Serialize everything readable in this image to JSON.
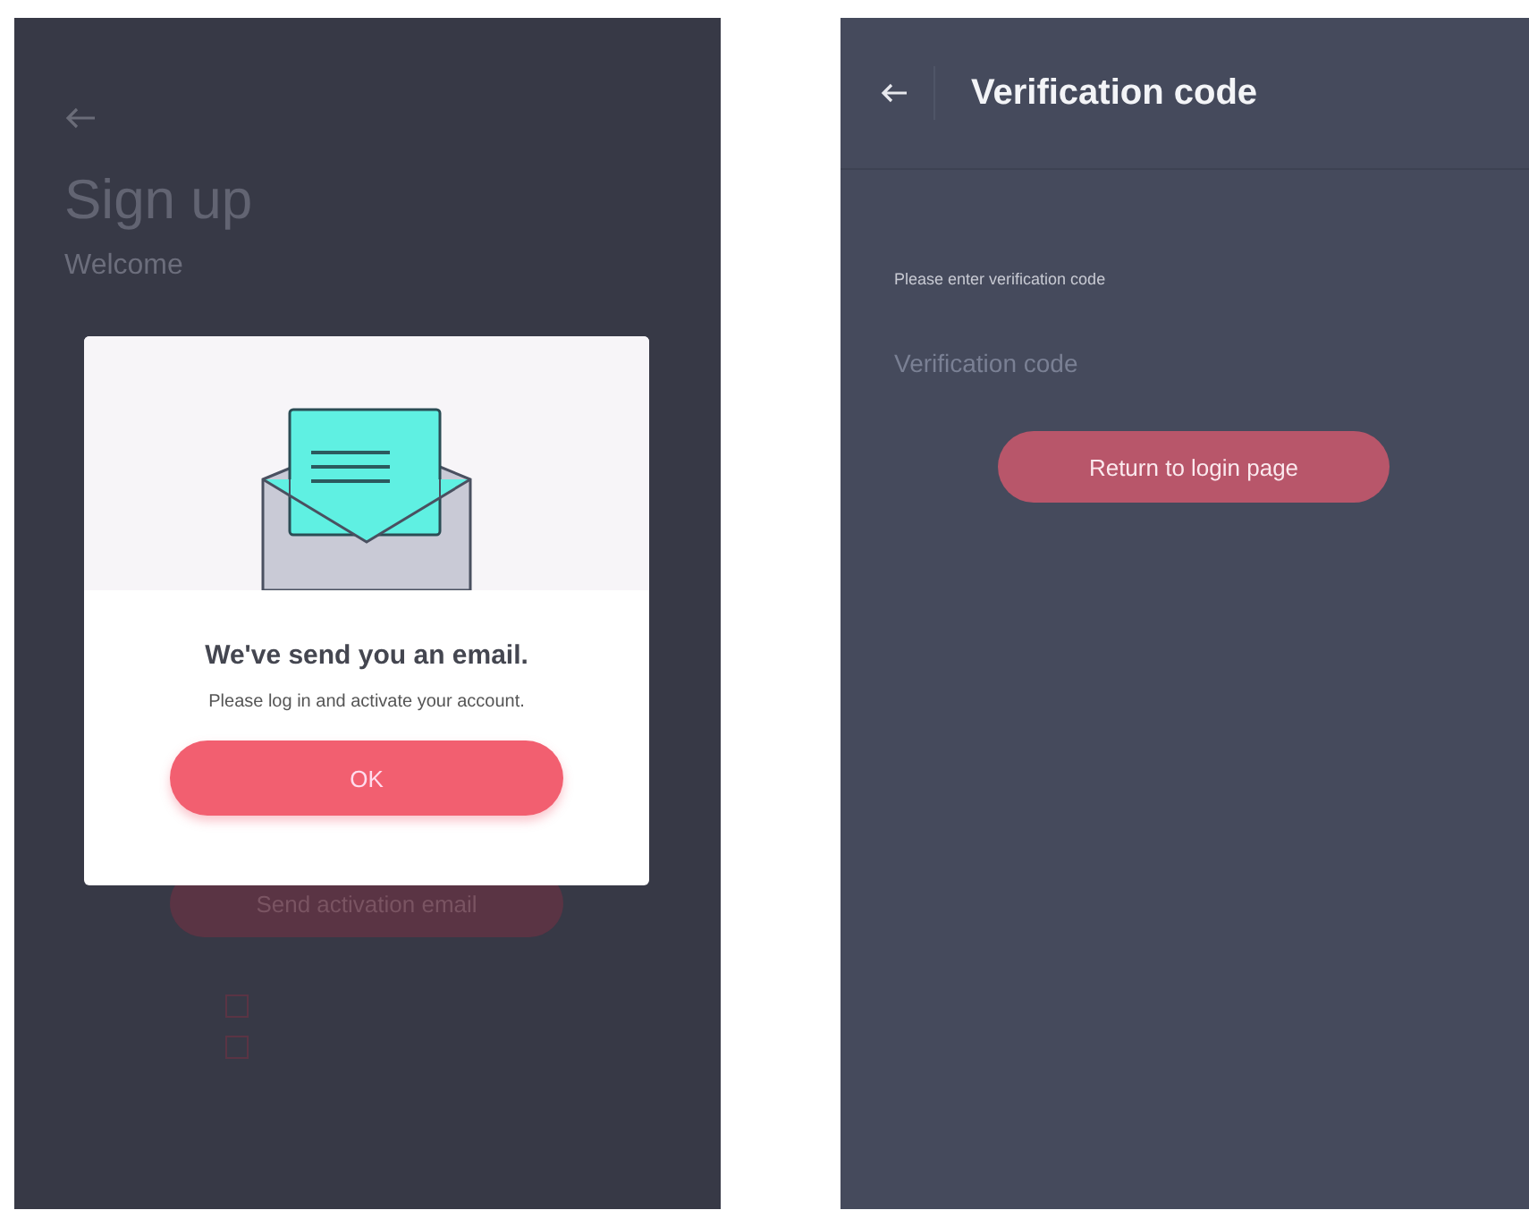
{
  "signup_screen": {
    "title": "Sign up",
    "subtitle": "Welcome",
    "background_button": "Send activation email",
    "checkboxes": [
      {
        "checked": false
      },
      {
        "checked": false
      }
    ]
  },
  "dialog": {
    "title": "We've send you an email.",
    "message": "Please log in and activate your account.",
    "button": "OK"
  },
  "verification_screen": {
    "header": {
      "title": "Verification code"
    },
    "label": "Please enter verification code",
    "field": {
      "placeholder": "Verification code"
    },
    "button": "Return to login page"
  }
}
